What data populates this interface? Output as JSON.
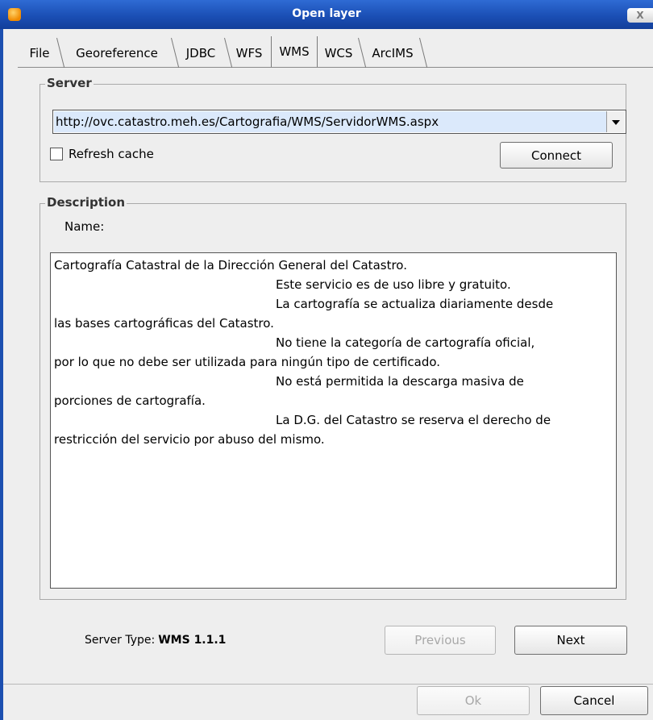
{
  "window": {
    "title": "Open layer",
    "close_label": "X"
  },
  "tabs": [
    {
      "label": "File"
    },
    {
      "label": "Georeference"
    },
    {
      "label": "JDBC"
    },
    {
      "label": "WFS"
    },
    {
      "label": "WMS",
      "active": true
    },
    {
      "label": "WCS"
    },
    {
      "label": "ArcIMS"
    }
  ],
  "server": {
    "group_title": "Server",
    "url": "http://ovc.catastro.meh.es/Cartografia/WMS/ServidorWMS.aspx",
    "refresh_cache_label": "Refresh cache",
    "refresh_cache_checked": false,
    "connect_label": "Connect"
  },
  "description": {
    "group_title": "Description",
    "name_label": "Name:",
    "lines": [
      "Cartografía Catastral de la Dirección General del Catastro.",
      "Este servicio es de uso libre y gratuito.",
      "La cartografía se actualiza diariamente desde",
      "las bases cartográficas del Catastro.",
      "No tiene la categoría de cartografía oficial,",
      "por lo que no debe ser utilizada para ningún tipo de certificado.",
      "No está permitida la descarga masiva de",
      "porciones de cartografía.",
      "La D.G. del Catastro se reserva el derecho de",
      "restricción del servicio por abuso del mismo."
    ]
  },
  "footer": {
    "server_type_label": "Server Type:",
    "server_type_value": "WMS 1.1.1",
    "previous_label": "Previous",
    "next_label": "Next",
    "ok_label": "Ok",
    "cancel_label": "Cancel"
  },
  "icons": [
    "app-icon",
    "close-icon",
    "chevron-down-icon",
    "checkbox"
  ],
  "colors": {
    "titlebar": "#1b4fb5",
    "selection": "#dbe9fb"
  }
}
